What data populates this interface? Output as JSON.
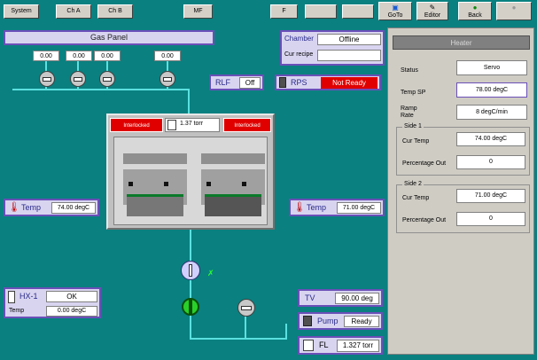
{
  "toolbar": {
    "system": "System",
    "ch_a": "Ch A",
    "ch_b": "Ch B",
    "mf": "MF",
    "f": "F",
    "btn_dim1": "",
    "btn_dim2": "",
    "goto": "GoTo",
    "editor": "Editor",
    "back": "Back",
    "forward": ""
  },
  "gas_panel": {
    "title": "Gas Panel",
    "readings": [
      "0.00",
      "0.00",
      "0.00",
      "0.00"
    ]
  },
  "chamber": {
    "label": "Chamber",
    "status": "Offline",
    "recipe_label": "Cur recipe",
    "recipe_value": ""
  },
  "rlf": {
    "label": "RLF",
    "value": "Off"
  },
  "rps": {
    "label": "RPS",
    "value": "Not Ready"
  },
  "interlocks": {
    "left": "Interlocked",
    "right": "Interlocked"
  },
  "pressure": {
    "value": "1.37 torr"
  },
  "temp_left": {
    "label": "Temp",
    "value": "74.00 degC"
  },
  "temp_right": {
    "label": "Temp",
    "value": "71.00 degC"
  },
  "hx": {
    "label": "HX-1",
    "status": "OK",
    "temp_label": "Temp",
    "temp_value": "0.00 degC"
  },
  "tv": {
    "label": "TV",
    "value": "90.00 deg"
  },
  "pump": {
    "label": "Pump",
    "value": "Ready"
  },
  "fl": {
    "label": "FL",
    "value": "1.327 torr"
  },
  "heater": {
    "header": "Heater",
    "status_label": "Status",
    "status_value": "Servo",
    "temp_sp_label": "Temp SP",
    "temp_sp_value": "78.00 degC",
    "ramp_label_1": "Ramp",
    "ramp_label_2": "Rate",
    "ramp_value": "8 degC/min",
    "side1": {
      "title": "Side 1",
      "cur_temp_label": "Cur Temp",
      "cur_temp_value": "74.00 degC",
      "pct_label": "Percentage Out",
      "pct_value": "0"
    },
    "side2": {
      "title": "Side 2",
      "cur_temp_label": "Cur Temp",
      "cur_temp_value": "71.00 degC",
      "pct_label": "Percentage Out",
      "pct_value": "0"
    }
  },
  "colors": {
    "background": "#0a8080",
    "pipe": "#5ce0e0",
    "border": "#6a4fb8",
    "alarm": "#e00000"
  }
}
